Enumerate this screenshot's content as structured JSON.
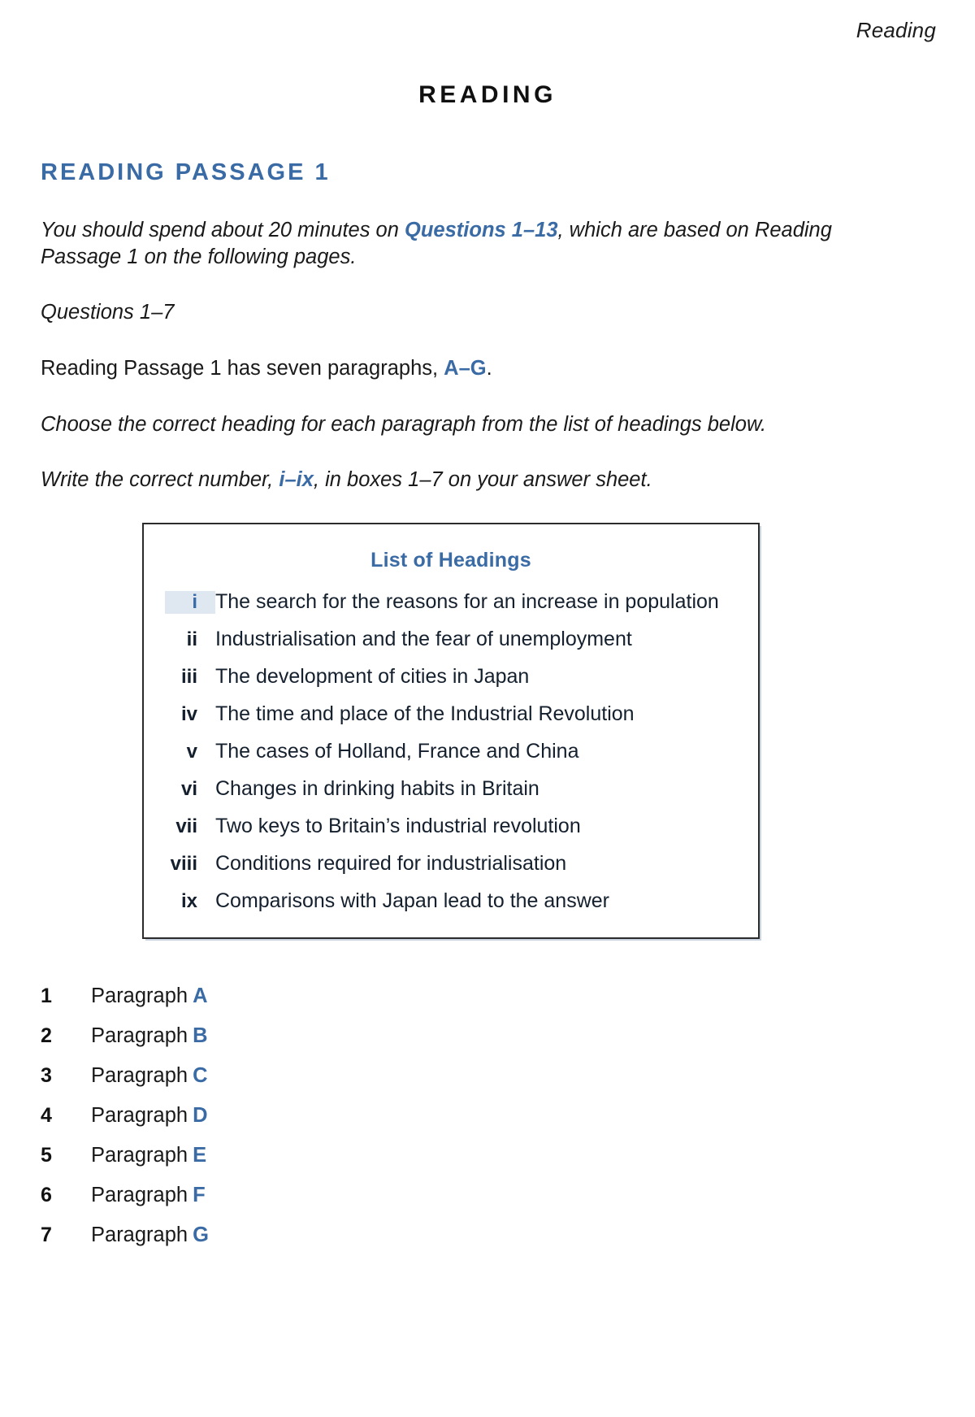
{
  "running_head": "Reading",
  "doc_title": "READING",
  "section_heading": "READING PASSAGE 1",
  "colors": {
    "accent_blue": "#3a6ba5",
    "text_black": "#1a1a1a",
    "box_border": "#2b2b2b",
    "highlight_bg": "#dfe8f1"
  },
  "intro": {
    "part1": "You should spend about 20 minutes on ",
    "emphasis": "Questions 1–13",
    "part2": ", which are based on Reading Passage 1 on the following pages."
  },
  "questions_range_label": "Questions 1–7",
  "paragraph_count_line": {
    "part1": "Reading Passage 1 has seven paragraphs, ",
    "emphasis": "A–G",
    "part2": "."
  },
  "choose_instruction": "Choose the correct heading for each paragraph from the list of headings below.",
  "write_instruction": {
    "part1": "Write the correct number, ",
    "emphasis": "i–ix",
    "part2": ", in boxes 1–7 on your answer sheet."
  },
  "headings_box": {
    "title": "List of Headings",
    "items": [
      {
        "numeral": "i",
        "text": "The search for the reasons for an increase in population",
        "highlighted": true
      },
      {
        "numeral": "ii",
        "text": "Industrialisation and the fear of unemployment",
        "highlighted": false
      },
      {
        "numeral": "iii",
        "text": "The development of cities in Japan",
        "highlighted": false
      },
      {
        "numeral": "iv",
        "text": "The time and place of the Industrial Revolution",
        "highlighted": false
      },
      {
        "numeral": "v",
        "text": "The cases of Holland, France and China",
        "highlighted": false
      },
      {
        "numeral": "vi",
        "text": "Changes in drinking habits in Britain",
        "highlighted": false
      },
      {
        "numeral": "vii",
        "text": "Two keys to Britain’s industrial revolution",
        "highlighted": false
      },
      {
        "numeral": "viii",
        "text": "Conditions required for industrialisation",
        "highlighted": false
      },
      {
        "numeral": "ix",
        "text": "Comparisons with Japan lead to the answer",
        "highlighted": false
      }
    ]
  },
  "answers": {
    "label": "Paragraph",
    "rows": [
      {
        "number": "1",
        "label": "Paragraph",
        "letter": "A"
      },
      {
        "number": "2",
        "label": "Paragraph",
        "letter": "B"
      },
      {
        "number": "3",
        "label": "Paragraph",
        "letter": "C"
      },
      {
        "number": "4",
        "label": "Paragraph",
        "letter": "D"
      },
      {
        "number": "5",
        "label": "Paragraph",
        "letter": "E"
      },
      {
        "number": "6",
        "label": "Paragraph",
        "letter": "F"
      },
      {
        "number": "7",
        "label": "Paragraph",
        "letter": "G"
      }
    ]
  }
}
